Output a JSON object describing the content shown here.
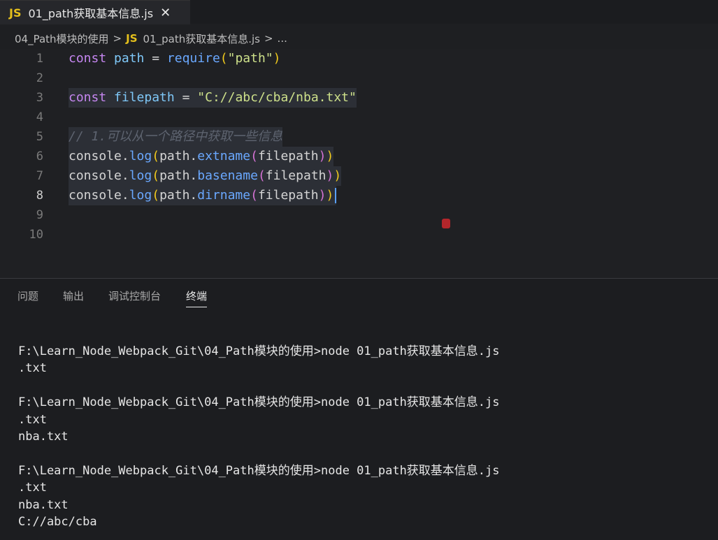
{
  "tab": {
    "badge": "JS",
    "title": "01_path获取基本信息.js",
    "close": "✕"
  },
  "breadcrumb": {
    "folder": "04_Path模块的使用",
    "sep1": ">",
    "badge": "JS",
    "file": "01_path获取基本信息.js",
    "sep2": ">",
    "more": "..."
  },
  "editor": {
    "lines": [
      {
        "n": "1"
      },
      {
        "n": "2"
      },
      {
        "n": "3"
      },
      {
        "n": "4"
      },
      {
        "n": "5"
      },
      {
        "n": "6"
      },
      {
        "n": "7"
      },
      {
        "n": "8"
      },
      {
        "n": "9"
      },
      {
        "n": "10"
      }
    ],
    "code": {
      "l1": {
        "kw": "const",
        "var": "path",
        "op": "=",
        "fn": "require",
        "open": "(",
        "str": "\"path\"",
        "close": ")"
      },
      "l3": {
        "kw": "const",
        "var": "filepath",
        "op": "=",
        "str": "\"C://abc/cba/nba.txt\""
      },
      "l5": {
        "comment": "// 1.可以从一个路径中获取一些信息"
      },
      "l6": {
        "obj": "console.",
        "fn": "log",
        "o1": "(",
        "p": "path.",
        "m": "extname",
        "o2": "(",
        "arg": "filepath",
        "c2": ")",
        "c1": ")"
      },
      "l7": {
        "obj": "console.",
        "fn": "log",
        "o1": "(",
        "p": "path.",
        "m": "basename",
        "o2": "(",
        "arg": "filepath",
        "c2": ")",
        "c1": ")"
      },
      "l8": {
        "obj": "console.",
        "fn": "log",
        "o1": "(",
        "p": "path.",
        "m": "dirname",
        "o2": "(",
        "arg": "filepath",
        "c2": ")",
        "c1": ")"
      }
    }
  },
  "panel": {
    "tabs": [
      "问题",
      "输出",
      "调试控制台",
      "终端"
    ],
    "active_tab": "终端"
  },
  "terminal": {
    "lines": [
      "F:\\Learn_Node_Webpack_Git\\04_Path模块的使用>node 01_path获取基本信息.js",
      ".txt",
      "",
      "F:\\Learn_Node_Webpack_Git\\04_Path模块的使用>node 01_path获取基本信息.js",
      ".txt",
      "nba.txt",
      "",
      "F:\\Learn_Node_Webpack_Git\\04_Path模块的使用>node 01_path获取基本信息.js",
      ".txt",
      "nba.txt",
      "C://abc/cba"
    ]
  },
  "colors": {
    "js_badge": "#e5c01c",
    "keyword": "#c586f0",
    "variable": "#7fc8f8",
    "function": "#6aa8ff",
    "string": "#cde08a",
    "comment": "#5e6470"
  }
}
